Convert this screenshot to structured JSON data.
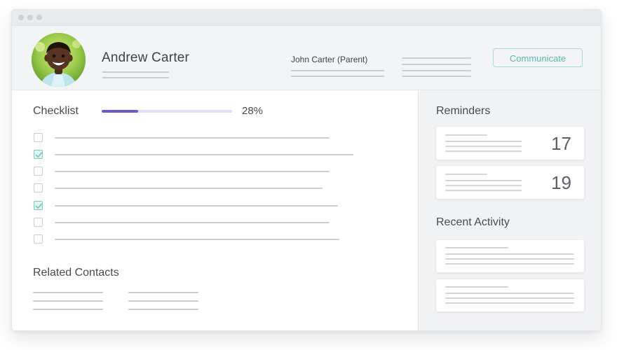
{
  "student": {
    "name": "Andrew Carter",
    "parent": "John Carter (Parent)"
  },
  "header": {
    "communicate_label": "Communicate"
  },
  "checklist": {
    "title": "Checklist",
    "progress_percent": 28,
    "progress_label": "28%",
    "items": [
      {
        "checked": false
      },
      {
        "checked": true
      },
      {
        "checked": false
      },
      {
        "checked": false
      },
      {
        "checked": true
      },
      {
        "checked": false
      },
      {
        "checked": false
      }
    ]
  },
  "related_contacts": {
    "title": "Related Contacts"
  },
  "reminders": {
    "title": "Reminders",
    "items": [
      {
        "count": "17"
      },
      {
        "count": "19"
      }
    ]
  },
  "recent_activity": {
    "title": "Recent Activity"
  },
  "colors": {
    "accent": "#6a5acd",
    "teal": "#59b8ae",
    "check": "#7cc9c0",
    "placeholder_line": "#c9ced3"
  },
  "icons": {
    "check": "checkmark-icon"
  }
}
